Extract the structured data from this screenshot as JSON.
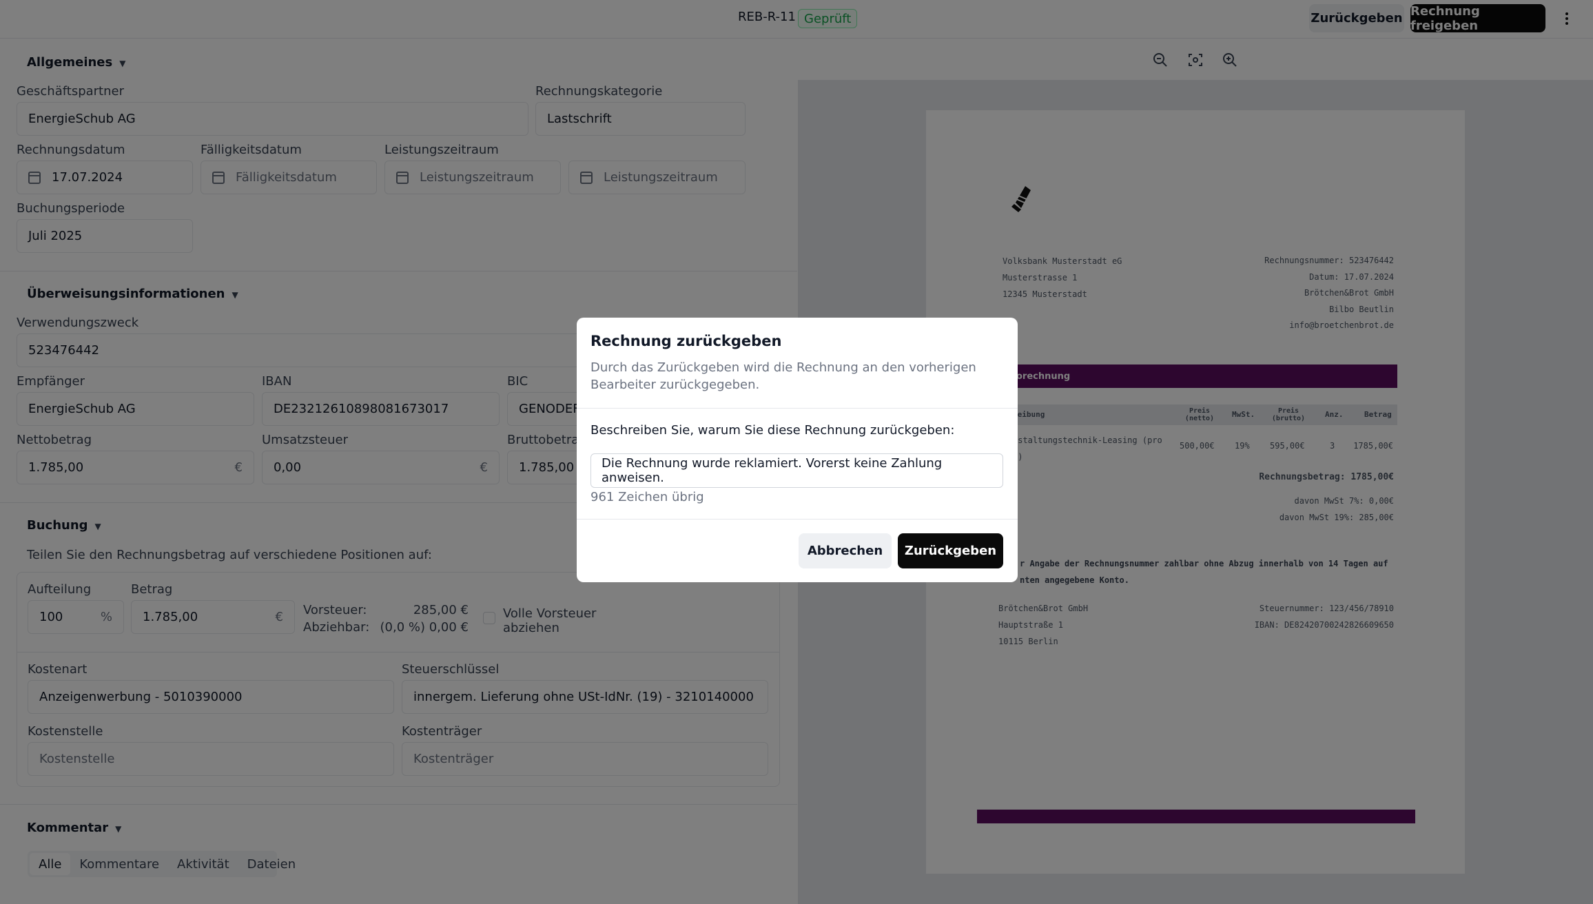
{
  "header": {
    "doc_id": "REB-R-11",
    "status_badge": "Geprüft",
    "return_button": "Zurückgeben",
    "approve_button": "Rechnung freigeben",
    "more_icon": "more-vertical-icon"
  },
  "general": {
    "title": "Allgemeines",
    "partner_label": "Geschäftspartner",
    "partner_value": "EnergieSchub AG",
    "category_label": "Rechnungskategorie",
    "category_value": "Lastschrift",
    "invoice_date_label": "Rechnungsdatum",
    "invoice_date_value": "17.07.2024",
    "due_date_label": "Fälligkeitsdatum",
    "due_date_placeholder": "Fälligkeitsdatum",
    "service_period_label": "Leistungszeitraum",
    "service_period_from_placeholder": "Leistungszeitraum",
    "service_period_to_placeholder": "Leistungszeitraum",
    "booking_period_label": "Buchungsperiode",
    "booking_period_value": "Juli 2025"
  },
  "transfer": {
    "title": "Überweisungsinformationen",
    "purpose_label": "Verwendungszweck",
    "purpose_value": "523476442",
    "recipient_label": "Empfänger",
    "recipient_value": "EnergieSchub AG",
    "iban_label": "IBAN",
    "iban_value": "DE23212610898081673017",
    "bic_label": "BIC",
    "bic_value": "GENODEF",
    "net_label": "Nettobetrag",
    "net_value": "1.785,00",
    "vat_label": "Umsatzsteuer",
    "vat_value": "0,00",
    "gross_label": "Bruttobetrag",
    "gross_value": "1.785,00",
    "currency": "€"
  },
  "booking": {
    "title": "Buchung",
    "subtitle": "Teilen Sie den Rechnungsbetrag auf verschiedene Positionen auf:",
    "split_label": "Aufteilung",
    "split_value": "100",
    "percent": "%",
    "amount_label": "Betrag",
    "amount_value": "1.785,00",
    "input_tax_label": "Vorsteuer:",
    "input_tax_value": "285,00 €",
    "deductible_label": "Abziehbar:",
    "deductible_value": "(0,0 %) 0,00 €",
    "full_input_tax_line1": "Volle Vorsteuer",
    "full_input_tax_line2": "abziehen",
    "cost_type_label": "Kostenart",
    "cost_type_value": "Anzeigenwerbung - 5010390000",
    "tax_key_label": "Steuerschlüssel",
    "tax_key_value": "innergem. Lieferung ohne USt-IdNr. (19) - 3210140000",
    "cost_center_label": "Kostenstelle",
    "cost_center_placeholder": "Kostenstelle",
    "cost_bearer_label": "Kostenträger",
    "cost_bearer_placeholder": "Kostenträger"
  },
  "comments": {
    "title": "Kommentar",
    "tabs": [
      "Alle",
      "Kommentare",
      "Aktivität",
      "Dateien"
    ]
  },
  "viewer": {
    "zoom_out_icon": "zoom-out-icon",
    "fit_icon": "fit-screen-icon",
    "zoom_in_icon": "zoom-in-icon",
    "pdf": {
      "sender": [
        "Volksbank Musterstadt eG",
        "Musterstrasse 1",
        "12345 Musterstadt"
      ],
      "meta": [
        "Rechnungsnummer: 523476442",
        "Datum: 17.07.2024",
        "Brötchen&Brot GmbH",
        "Bilbo Beutlin",
        "info@broetchenbrot.de"
      ],
      "banner": "orechnung",
      "table_headers": [
        "reibung",
        "Preis (netto)",
        "MwSt.",
        "Preis (brutto)",
        "Anz.",
        "Betrag"
      ],
      "row_desc": "nstaltungstechnik-Leasing (pro",
      "row_desc2": "t)",
      "row_values": [
        "500,00€",
        "19%",
        "595,00€",
        "3",
        "1785,00€"
      ],
      "total": "Rechnungsbetrag: 1785,00€",
      "vat7": "davon MwSt 7%: 0,00€",
      "vat19": "davon MwSt 19%: 285,00€",
      "payment_line1": "r Angabe der Rechnungsnummer zahlbar ohne Abzug innerhalb von 14 Tagen auf",
      "payment_line2": "nten angegebene Konto.",
      "footer_left": [
        "Brötchen&Brot GmbH",
        "Hauptstraße 1",
        "10115 Berlin"
      ],
      "footer_right": [
        "Steuernummer: 123/456/78910",
        "IBAN: DE82420700242826609650"
      ]
    }
  },
  "modal": {
    "title": "Rechnung zurückgeben",
    "description": "Durch das Zurückgeben wird die Rechnung an den vorherigen Bearbeiter zurückgegeben.",
    "prompt": "Beschreiben Sie, warum Sie diese Rechnung zurückgeben:",
    "reason_value": "Die Rechnung wurde reklamiert. Vorerst keine Zahlung anweisen.",
    "chars_left": "961 Zeichen übrig",
    "cancel_button": "Abbrechen",
    "submit_button": "Zurückgeben"
  },
  "colors": {
    "pdf_accent": "#5b0d5f",
    "badge_green": "#16a34a",
    "primary_dark": "#0a0a0a"
  }
}
